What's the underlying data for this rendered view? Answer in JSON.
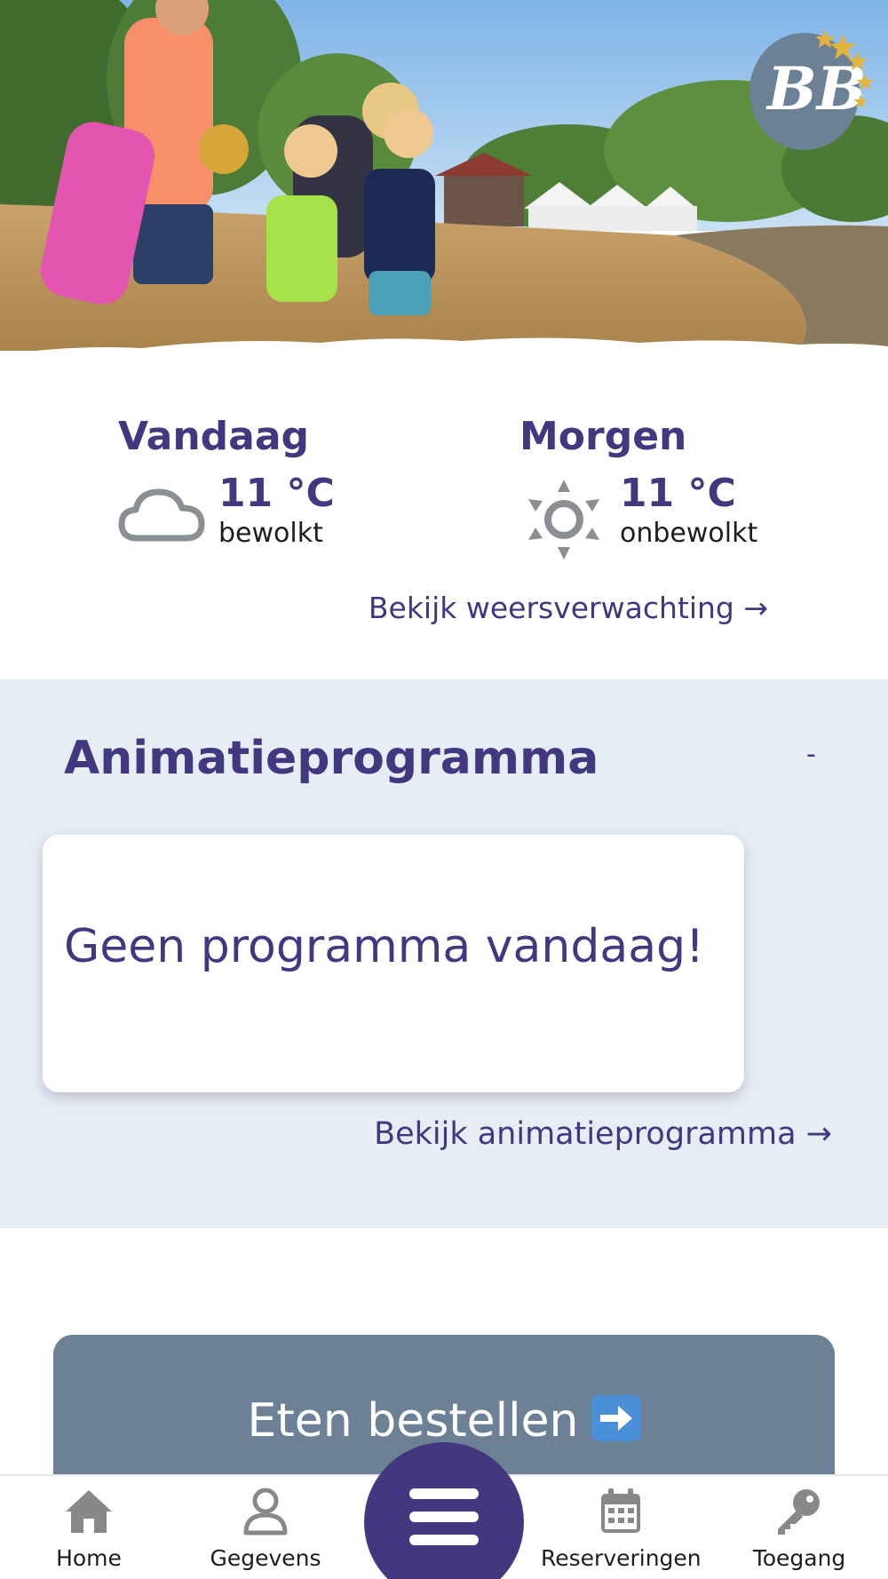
{
  "colors": {
    "brand_purple": "#433880",
    "section_bg": "#e7edf5",
    "order_button_bg": "#6c8196",
    "icon_gray": "#888888"
  },
  "hero": {
    "image": "beach-family-photo",
    "logo_text": "BB"
  },
  "weather": {
    "today": {
      "day": "Vandaag",
      "temp": "11 °C",
      "description": "bewolkt",
      "icon": "cloud-icon"
    },
    "tomorrow": {
      "day": "Morgen",
      "temp": "11 °C",
      "description": "onbewolkt",
      "icon": "sun-icon"
    },
    "link": "Bekijk weersverwachting →"
  },
  "animation": {
    "title": "Animatieprogramma",
    "toggle": "-",
    "card_text": "Geen programma vandaag!",
    "link": "Bekijk animatieprogramma →"
  },
  "order": {
    "label": "Eten bestellen",
    "icon": "right-arrow-emoji"
  },
  "nav": {
    "items": [
      {
        "label": "Home",
        "icon": "home-icon"
      },
      {
        "label": "Gegevens",
        "icon": "user-icon"
      },
      {
        "label": "Reserveringen",
        "icon": "calendar-icon"
      },
      {
        "label": "Toegang",
        "icon": "key-icon"
      }
    ],
    "menu_icon": "menu-icon"
  }
}
